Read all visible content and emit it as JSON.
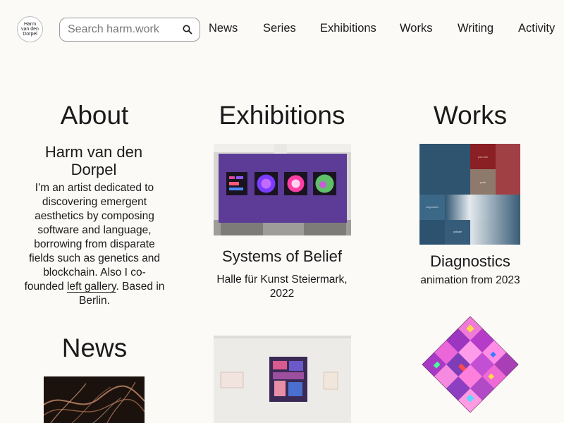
{
  "logo": {
    "line1": "Harm",
    "line2": "van den",
    "line3": "Dorpel"
  },
  "search": {
    "placeholder": "Search harm.work"
  },
  "nav": [
    "News",
    "Series",
    "Exhibitions",
    "Works",
    "Writing",
    "Activity"
  ],
  "about": {
    "heading": "About",
    "name": "Harm van den Dorpel",
    "bio_before": "I'm an artist dedicated to discovering emergent aesthetics by composing software and language, borrowing from disparate fields such as genetics and blockchain. Also I co-founded ",
    "bio_link": "left gallery",
    "bio_after": ". Based in Berlin."
  },
  "exhibitions": {
    "heading": "Exhibitions",
    "item_title": "Systems of Belief",
    "item_subtitle": "Halle für Kunst Steiermark, 2022"
  },
  "works": {
    "heading": "Works",
    "item_title": "Diagnostics",
    "item_subtitle": "animation from 2023",
    "thumb_text": [
      "your love",
      "pools",
      "diagnostics",
      "activate"
    ]
  },
  "news": {
    "heading": "News"
  },
  "colors": {
    "background": "#fcfaf7",
    "text": "#1a1a1a",
    "purple_wall": "#5c3c97",
    "works_blue": "#2f5571",
    "works_red": "#8a1f24",
    "magenta": "#d94bd0"
  }
}
